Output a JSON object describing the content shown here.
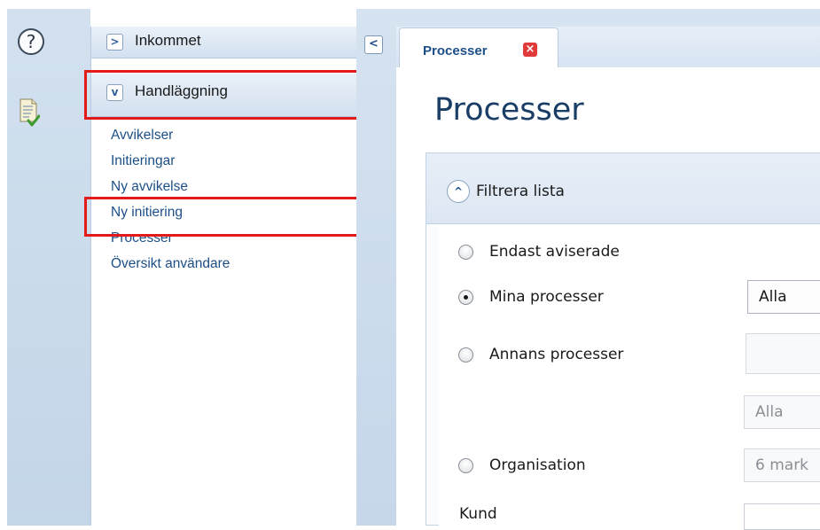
{
  "rail": {
    "help_glyph": "?",
    "help_icon": "help-circle-icon",
    "doc_icon": "document-check-icon"
  },
  "nav": {
    "sections": [
      {
        "label": "Inkommet",
        "state": "collapsed",
        "chevron": ">"
      },
      {
        "label": "Handläggning",
        "state": "expanded",
        "chevron": "v"
      }
    ],
    "items": [
      "Avvikelser",
      "Initieringar",
      "Ny avvikelse",
      "Ny initiering",
      "Processer",
      "Översikt användare"
    ],
    "collapse_glyph": "<"
  },
  "tabs": [
    {
      "label": "Processer",
      "active": true,
      "close_glyph": "×"
    }
  ],
  "page": {
    "title": "Processer"
  },
  "filter": {
    "toggle_glyph": "^",
    "title": "Filtrera lista",
    "options": [
      {
        "label": "Endast aviserade",
        "selected": false
      },
      {
        "label": "Mina processer",
        "selected": true,
        "field_value": "Alla"
      },
      {
        "label": "Annans processer",
        "selected": false,
        "field_value": ""
      },
      {
        "label": "",
        "selected": false,
        "field_value": "Alla"
      },
      {
        "label": "Organisation",
        "selected": false,
        "field_value": "6 mark"
      }
    ],
    "kund_label": "Kund",
    "kund_value": ""
  },
  "colors": {
    "highlight": "#e31a1a",
    "link": "#1c4f86",
    "title": "#1a3d66",
    "panel_blue": "#d3e1ef"
  }
}
